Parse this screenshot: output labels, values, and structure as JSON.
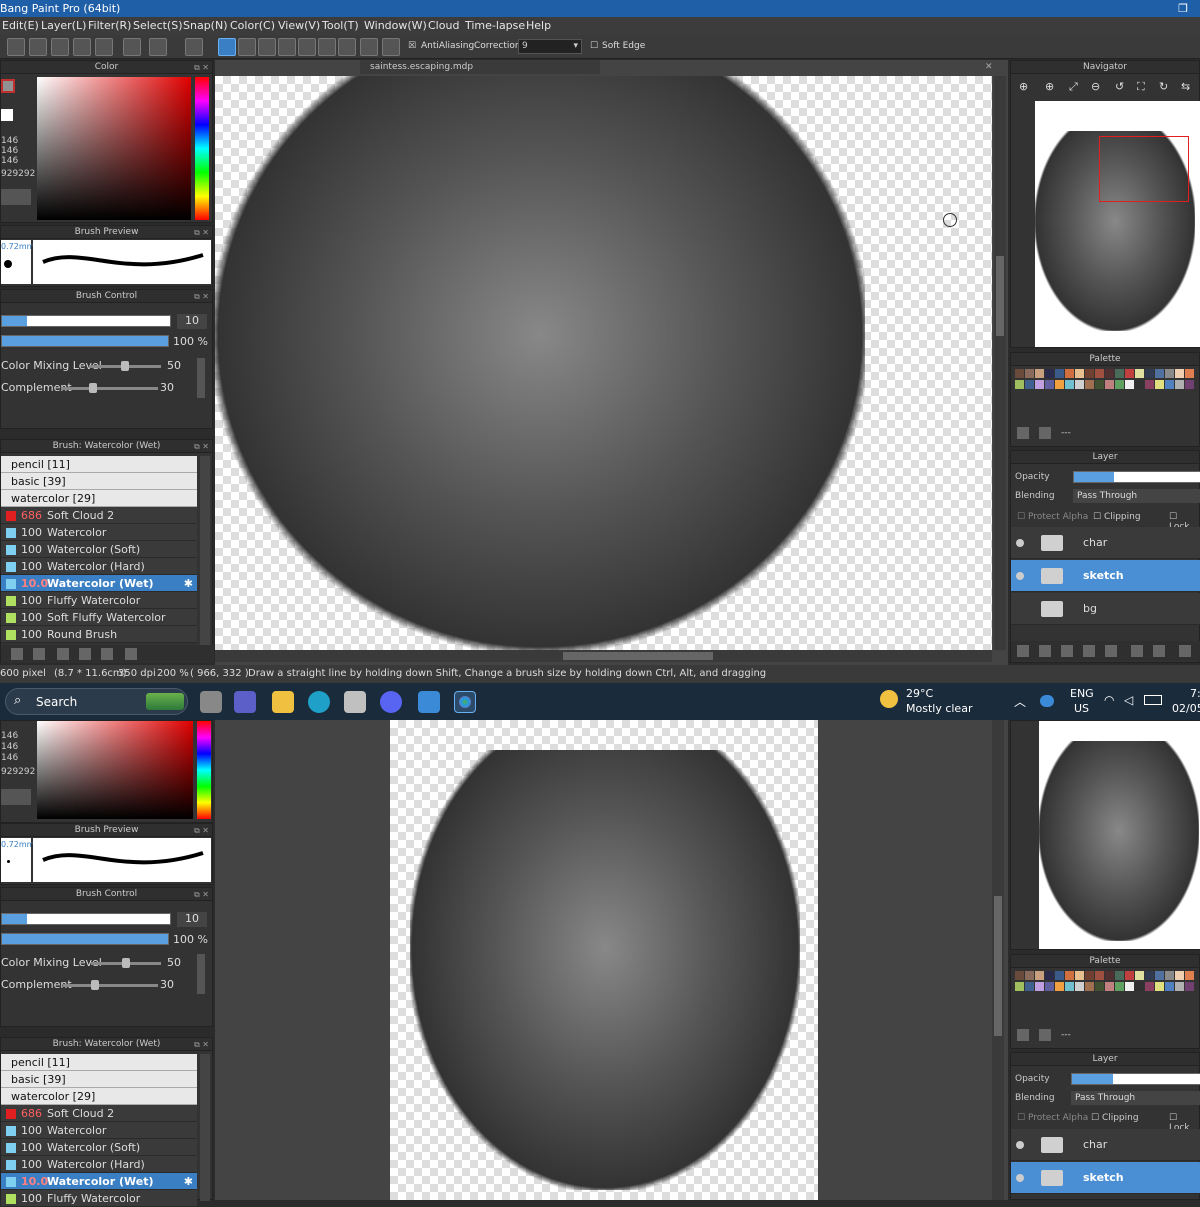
{
  "title": "Bang Paint Pro (64bit)",
  "menu": [
    "Edit(E)",
    "Layer(L)",
    "Filter(R)",
    "Select(S)",
    "Snap(N)",
    "Color(C)",
    "View(V)",
    "Tool(T)",
    "Window(W)",
    "Cloud",
    "Time-lapse",
    "Help"
  ],
  "toolbar": {
    "antialiasing": "AntiAliasing",
    "correction_label": "Correction",
    "correction_value": "9",
    "soft_edge": "Soft Edge"
  },
  "document_tab": "saintess.escaping.mdp",
  "color_panel": {
    "title": "Color",
    "r": "146",
    "g": "146",
    "b": "146",
    "hex": "929292"
  },
  "brush_preview": {
    "title": "Brush Preview",
    "size": "0.72mm"
  },
  "brush_control": {
    "title": "Brush Control",
    "size_value": "10",
    "opacity_value": "100 %",
    "mixing_label": "Color Mixing Level",
    "mixing_value": "50",
    "complement_label": "Complement",
    "complement_value": "30",
    "mixing_level": 50,
    "complement_level": 30
  },
  "brush_panel": {
    "title": "Brush: Watercolor (Wet)",
    "groups": [
      "pencil [11]",
      "basic [39]",
      "watercolor [29]"
    ],
    "items": [
      {
        "num": "686",
        "name": "Soft Cloud 2",
        "color": "#e02020"
      },
      {
        "num": "100",
        "name": "Watercolor",
        "color": "#7fd0f0"
      },
      {
        "num": "100",
        "name": "Watercolor (Soft)",
        "color": "#7fd0f0"
      },
      {
        "num": "100",
        "name": "Watercolor (Hard)",
        "color": "#7fd0f0"
      },
      {
        "num": "10.0",
        "name": "Watercolor (Wet)",
        "color": "#7fd0f0"
      },
      {
        "num": "100",
        "name": "Fluffy Watercolor",
        "color": "#b0e060"
      },
      {
        "num": "100",
        "name": "Soft Fluffy Watercolor",
        "color": "#b0e060"
      },
      {
        "num": "100",
        "name": "Round Brush",
        "color": "#b0e060"
      }
    ]
  },
  "navigator": {
    "title": "Navigator"
  },
  "palette": {
    "title": "Palette",
    "colors": [
      "#6a4a3a",
      "#8a6a5a",
      "#c8a080",
      "#2a2a4a",
      "#3a5a8a",
      "#d07040",
      "#e8c090",
      "#704030",
      "#a05040",
      "#503030",
      "#4a6a5a",
      "#c04040",
      "#e0e0a0",
      "#303a50",
      "#5070a0",
      "#8a8a8a",
      "#f0d0b0",
      "#e08050",
      "#a0c060",
      "#406090",
      "#c0a0e0",
      "#6060a0",
      "#f0a040",
      "#70c0d0",
      "#d0d0d0",
      "#a07050",
      "#405030",
      "#c08080",
      "#60a060",
      "#f0f0f0",
      "#303030",
      "#8a4060",
      "#e0e080",
      "#5080c0",
      "#b0b0b0",
      "#704070"
    ]
  },
  "layer_panel": {
    "title": "Layer",
    "opacity_label": "Opacity",
    "blending_label": "Blending",
    "blending_value": "Pass Through",
    "protect_alpha": "Protect Alpha",
    "clipping": "Clipping",
    "lock": "Lock",
    "layers": [
      "char",
      "sketch",
      "bg"
    ],
    "palette_extra": "---"
  },
  "status": {
    "size": "600 pixel",
    "dims": "(8.7 * 11.6cm)",
    "dpi": "350 dpi",
    "zoom": "200 %",
    "coords": "( 966, 332 )",
    "hint": "Draw a straight line by holding down Shift, Change a brush size by holding down Ctrl, Alt, and dragging"
  },
  "taskbar": {
    "search": "Search",
    "weather_temp": "29°C",
    "weather_desc": "Mostly clear",
    "lang1": "ENG",
    "lang2": "US",
    "time": "7:",
    "date": "02/05"
  },
  "bottom": {
    "brush_title": "Brush: Watercolor (Wet)",
    "layer_title": "Layer",
    "palette_title": "Palette",
    "navigator_title": "Navigator"
  }
}
